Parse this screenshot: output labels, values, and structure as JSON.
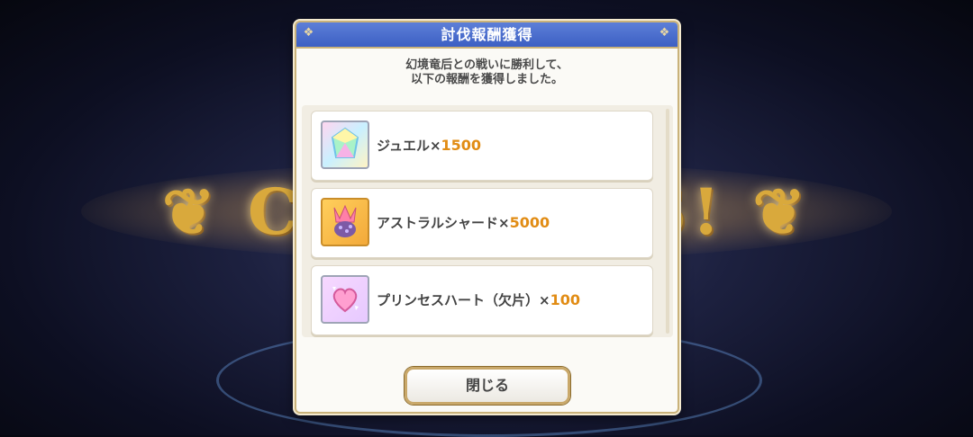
{
  "dialog": {
    "title": "討伐報酬獲得",
    "message_line1": "幻境竜后との戦いに勝利して、",
    "message_line2": "以下の報酬を獲得しました。",
    "close_label": "閉じる"
  },
  "rewards": [
    {
      "name": "ジュエル×",
      "qty": "1500",
      "icon": "jewel-icon"
    },
    {
      "name": "アストラルシャード×",
      "qty": "5000",
      "icon": "astral-shard-icon"
    },
    {
      "name": "プリンセスハート（欠片）×",
      "qty": "100",
      "icon": "princess-heart-icon"
    }
  ],
  "colors": {
    "title_bar": "#3c5fc3",
    "quantity": "#e18c14",
    "frame": "#c9b27a"
  }
}
